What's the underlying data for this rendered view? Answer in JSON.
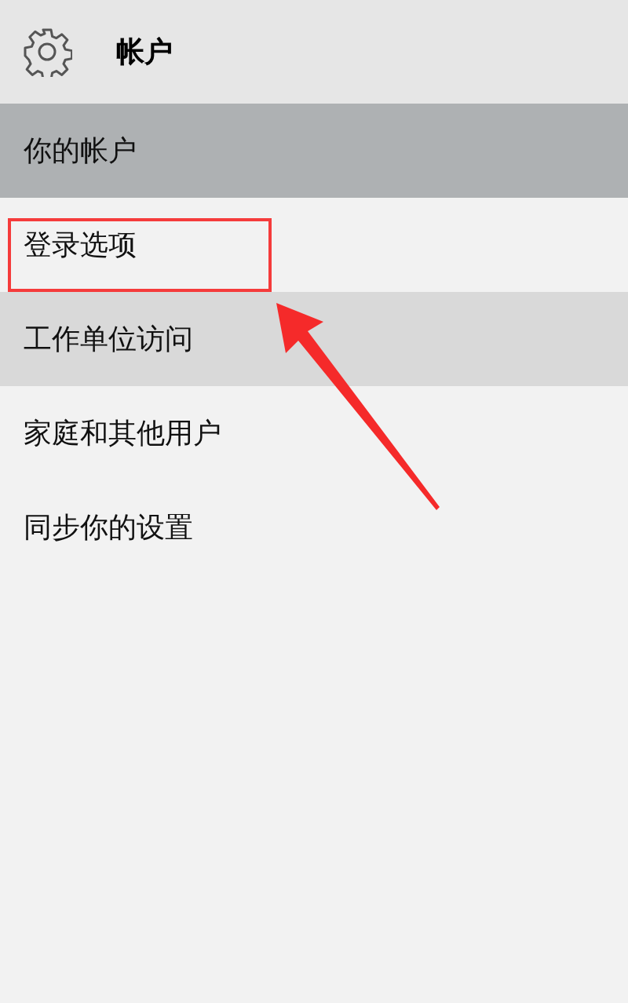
{
  "header": {
    "title": "帐户"
  },
  "nav_items": [
    {
      "label": "你的帐户",
      "selected": true,
      "hovered": false,
      "highlighted": false
    },
    {
      "label": "登录选项",
      "selected": false,
      "hovered": false,
      "highlighted": true
    },
    {
      "label": "工作单位访问",
      "selected": false,
      "hovered": true,
      "highlighted": false
    },
    {
      "label": "家庭和其他用户",
      "selected": false,
      "hovered": false,
      "highlighted": false
    },
    {
      "label": "同步你的设置",
      "selected": false,
      "hovered": false,
      "highlighted": false
    }
  ]
}
